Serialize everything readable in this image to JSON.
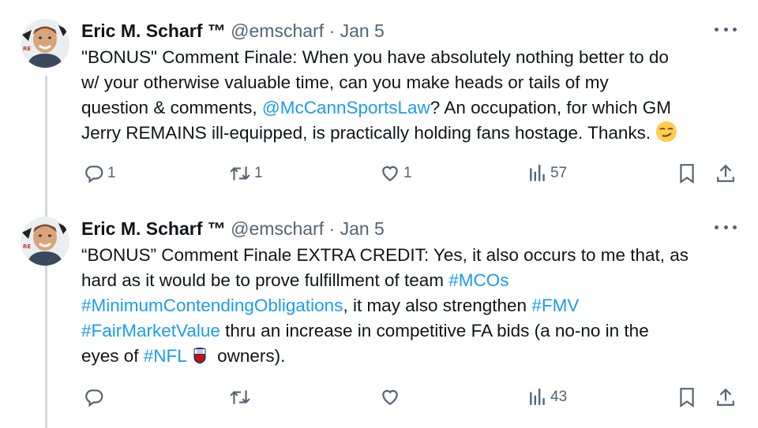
{
  "tweets": [
    {
      "author_name": "Eric M. Scharf ™",
      "handle": "@emscharf",
      "separator": "·",
      "date": "Jan 5",
      "lines": [
        [
          "\"BONUS\" Comment Finale: When you have absolutely nothing better to do"
        ],
        [
          "w/ your otherwise valuable time, can you make heads or tails of my"
        ],
        [
          "question & comments, ",
          "@McCannSportsLaw",
          "? An occupation, for which GM"
        ],
        [
          "Jerry REMAINS ill-equipped, is practically holding fans hostage. Thanks."
        ]
      ],
      "actions": {
        "replies": "1",
        "reposts": "1",
        "likes": "1",
        "views": "57"
      }
    },
    {
      "author_name": "Eric M. Scharf ™",
      "handle": "@emscharf",
      "separator": "·",
      "date": "Jan 5",
      "lines": [
        [
          "“BONUS” Comment Finale EXTRA CREDIT: Yes, it also occurs to me that, as"
        ],
        [
          "hard as it would be to prove fulfillment of team ",
          "#MCOs"
        ],
        [
          "#MinimumContendingObligations",
          ", it may also strengthen ",
          "#FMV"
        ],
        [
          "#FairMarketValue",
          " thru an increase in competitive FA bids (a no-no in the"
        ],
        [
          "eyes of ",
          "#NFL",
          " owners)."
        ]
      ],
      "actions": {
        "replies": "",
        "reposts": "",
        "likes": "",
        "views": "43"
      }
    }
  ],
  "icons": {
    "avatar": "avatar-image",
    "more": "more-options-icon",
    "reply": "reply-icon",
    "repost": "repost-icon",
    "like": "heart-icon",
    "views": "views-icon",
    "bookmark": "bookmark-icon",
    "share": "share-icon",
    "emoji": "smirking-face-emoji",
    "nfl": "nfl-shield-logo"
  },
  "colors": {
    "link": "#1d9bf0",
    "muted": "#536471",
    "text": "#0f1419",
    "thread_line": "#cfd9de"
  }
}
